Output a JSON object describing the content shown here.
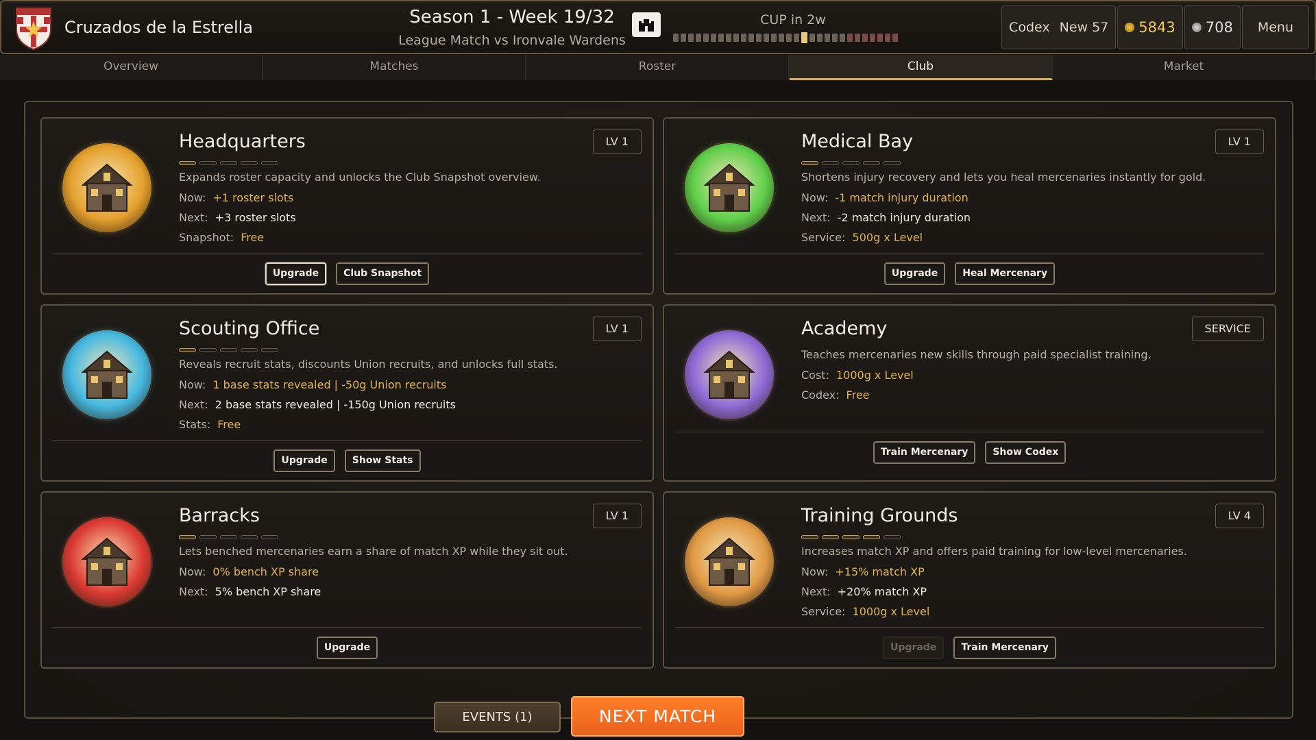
{
  "header": {
    "club_name": "Cruzados de la Estrella",
    "season_title": "Season 1 - Week 19/32",
    "match_subtitle": "League Match vs Ironvale Wardens",
    "cup_label": "CUP in 2w",
    "cup_progress": {
      "total_segments": 30,
      "current_segment": 17
    },
    "codex_label": "Codex",
    "codex_new": "New 57",
    "gold": "5843",
    "silver": "708",
    "menu_label": "Menu",
    "icons": {
      "crest": "shield-cross-icon",
      "castle": "castle-icon",
      "gold": "gold-coin-icon",
      "silver": "silver-coin-icon"
    }
  },
  "tabs": [
    {
      "label": "Overview",
      "active": false
    },
    {
      "label": "Matches",
      "active": false
    },
    {
      "label": "Roster",
      "active": false
    },
    {
      "label": "Club",
      "active": true
    },
    {
      "label": "Market",
      "active": false
    }
  ],
  "buildings": [
    {
      "name": "Headquarters",
      "level": "LV 1",
      "pips_filled": 1,
      "pips_total": 5,
      "description": "Expands roster capacity and unlocks the Club Snapshot overview.",
      "rows": [
        {
          "label": "Now:",
          "value": "+1 roster slots",
          "style": "y"
        },
        {
          "label": "Next:",
          "value": "+3 roster slots",
          "style": "w"
        },
        {
          "label": "Snapshot:",
          "value": "Free",
          "style": "y"
        }
      ],
      "buttons": [
        "Upgrade",
        "Club Snapshot"
      ],
      "icon_color": "#e5a02c"
    },
    {
      "name": "Medical Bay",
      "level": "LV 1",
      "pips_filled": 1,
      "pips_total": 5,
      "description": "Shortens injury recovery and lets you heal mercenaries instantly for gold.",
      "rows": [
        {
          "label": "Now:",
          "value": "-1 match injury duration",
          "style": "y"
        },
        {
          "label": "Next:",
          "value": "-2 match injury duration",
          "style": "w"
        },
        {
          "label": "Service:",
          "value": "500g x Level",
          "style": "y"
        }
      ],
      "buttons": [
        "Upgrade",
        "Heal Mercenary"
      ],
      "icon_color": "#5fcf4a"
    },
    {
      "name": "Scouting Office",
      "level": "LV 1",
      "pips_filled": 1,
      "pips_total": 5,
      "description": "Reveals recruit stats, discounts Union recruits, and unlocks full stats.",
      "rows": [
        {
          "label": "Now:",
          "value": "1 base stats revealed | -50g Union recruits",
          "style": "y"
        },
        {
          "label": "Next:",
          "value": "2 base stats revealed | -150g Union recruits",
          "style": "w"
        },
        {
          "label": "Stats:",
          "value": "Free",
          "style": "y"
        }
      ],
      "buttons": [
        "Upgrade",
        "Show Stats"
      ],
      "icon_color": "#45b8e0"
    },
    {
      "name": "Academy",
      "level": "SERVICE",
      "pips_filled": 0,
      "pips_total": 0,
      "description": "Teaches mercenaries new skills through paid specialist training.",
      "rows": [
        {
          "label": "Cost:",
          "value": "1000g x Level",
          "style": "y"
        },
        {
          "label": "Codex:",
          "value": "Free",
          "style": "y"
        }
      ],
      "buttons": [
        "Train Mercenary",
        "Show Codex"
      ],
      "icon_color": "#8e6ad6"
    },
    {
      "name": "Barracks",
      "level": "LV 1",
      "pips_filled": 1,
      "pips_total": 5,
      "description": "Lets benched mercenaries earn a share of match XP while they sit out.",
      "rows": [
        {
          "label": "Now:",
          "value": "0% bench XP share",
          "style": "y"
        },
        {
          "label": "Next:",
          "value": "5% bench XP share",
          "style": "w"
        }
      ],
      "buttons": [
        "Upgrade"
      ],
      "icon_color": "#dc3a32"
    },
    {
      "name": "Training Grounds",
      "level": "LV 4",
      "pips_filled": 4,
      "pips_total": 5,
      "description": "Increases match XP and offers paid training for low-level mercenaries.",
      "rows": [
        {
          "label": "Now:",
          "value": "+15% match XP",
          "style": "y"
        },
        {
          "label": "Next:",
          "value": "+20% match XP",
          "style": "w"
        },
        {
          "label": "Service:",
          "value": "1000g x Level",
          "style": "y"
        }
      ],
      "buttons": [
        "Upgrade",
        "Train Mercenary"
      ],
      "icon_color": "#e09a45"
    }
  ],
  "footer": {
    "events_label": "EVENTS (1)",
    "next_match_label": "NEXT MATCH"
  },
  "colors": {
    "accent": "#d8b35a",
    "highlight_value": "#e0b34f",
    "next_match": "#ff7f2a"
  }
}
